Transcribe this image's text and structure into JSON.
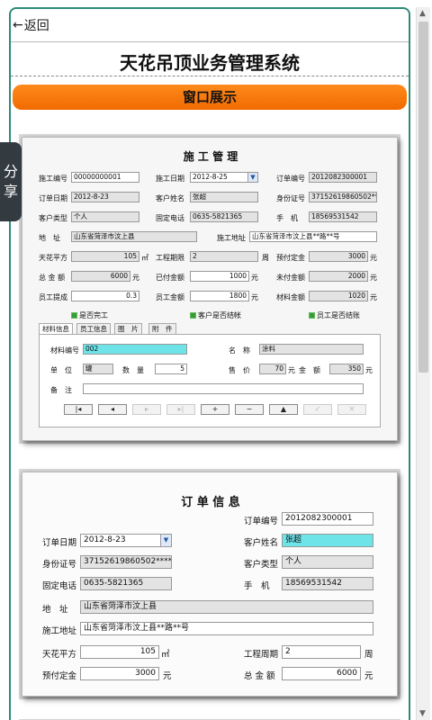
{
  "nav": {
    "back_icon": "←",
    "back_label": "返回"
  },
  "app_title": "天花吊顶业务管理系统",
  "section_label": "窗口展示",
  "share": {
    "line1": "分",
    "line2": "享"
  },
  "shot1": {
    "title": "施 工 管 理",
    "labels": {
      "worknum": "施工编号",
      "workdate": "施工日期",
      "ordernum": "订单编号",
      "orderdate": "订单日期",
      "custname": "客户姓名",
      "idnum": "身份证号",
      "custtype": "客户类型",
      "phone": "固定电话",
      "mobile": "手　机",
      "addr": "地　址",
      "workaddr": "施工地址",
      "area": "天花平方",
      "period": "工程期限",
      "deposit": "预付定金",
      "total": "总 金 额",
      "paid": "已付金额",
      "unpaid": "未付金额",
      "staffcomm": "员工提成",
      "staffamt": "员工金额",
      "materialamt": "材料金额"
    },
    "values": {
      "worknum": "00000000001",
      "workdate": "2012-8-25",
      "ordernum": "2012082300001",
      "orderdate": "2012-8-23",
      "custname": "张超",
      "idnum": "37152619860502****",
      "custtype": "个人",
      "phone": "0635-5821365",
      "mobile": "18569531542",
      "addr": "山东省菏泽市汶上县",
      "workaddr": "山东省菏泽市汶上县**路**号",
      "area": "105",
      "period": "2",
      "deposit": "3000",
      "total": "6000",
      "paid": "1000",
      "unpaid": "2000",
      "staffcomm": "0.3",
      "staffamt": "1800",
      "materialamt": "1020"
    },
    "units": {
      "area_unit": "㎡",
      "period_unit": "周",
      "yuan": "元"
    },
    "checks": {
      "done": "是否完工",
      "cust_settled": "客户是否结帐",
      "staff_settled": "员工是否结账"
    },
    "tabs": [
      "材料信息",
      "员工信息",
      "图　片",
      "附　件"
    ],
    "material": {
      "code_label": "材料编号",
      "code": "002",
      "name_label": "名　称",
      "name": "涂料",
      "unit_label": "单　位",
      "unit": "罐",
      "qty_label": "数　量",
      "qty": "5",
      "price_label": "售　价",
      "price": "70",
      "amount_label": "金　额",
      "amount": "350",
      "note_label": "备　注",
      "note": ""
    },
    "nav_buttons": [
      "|◂",
      "◂",
      "▸",
      "▸|",
      "+",
      "−",
      "▲",
      "✓",
      "✕"
    ]
  },
  "shot2": {
    "title": "订 单 信 息",
    "labels": {
      "ordernum": "订单编号",
      "orderdate": "订单日期",
      "custname": "客户姓名",
      "idnum": "身份证号",
      "custtype": "客户类型",
      "phone": "固定电话",
      "mobile": "手　机",
      "addr": "地　址",
      "workaddr": "施工地址",
      "area": "天花平方",
      "period": "工程周期",
      "deposit": "预付定金",
      "total": "总 金 额"
    },
    "values": {
      "ordernum": "2012082300001",
      "orderdate": "2012-8-23",
      "custname": "张超",
      "idnum": "37152619860502****",
      "custtype": "个人",
      "phone": "0635-5821365",
      "mobile": "18569531542",
      "addr": "山东省菏泽市汶上县",
      "workaddr": "山东省菏泽市汶上县**路**号",
      "area": "105",
      "period": "2",
      "deposit": "3000",
      "total": "6000"
    },
    "units": {
      "area_unit": "㎡",
      "period_unit": "周",
      "yuan": "元"
    }
  },
  "scroll": {
    "up": "▲",
    "down": "▼"
  },
  "colors": {
    "frame": "#2e8b78",
    "orange": "#f57a0a",
    "cyan": "#6ee3e8"
  },
  "icons": {
    "back": "back-arrow-icon",
    "chevron": "chevron-down-icon",
    "checkbox": "checkbox-icon"
  }
}
